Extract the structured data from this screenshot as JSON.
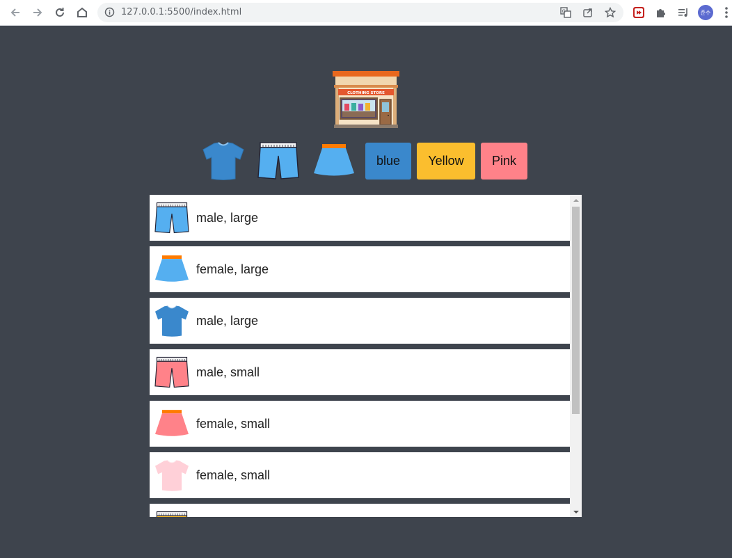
{
  "browser": {
    "url": "127.0.0.1:5500/index.html",
    "profile_initials": "준수",
    "icons": [
      "back-icon",
      "forward-icon",
      "reload-icon",
      "home-icon",
      "info-icon",
      "translate-icon",
      "share-icon",
      "bookmark-star-icon",
      "extension-red-icon",
      "puzzle-icon",
      "media-queue-icon",
      "menu-dots-icon"
    ]
  },
  "page": {
    "logo_sign": "CLOTHING STORE",
    "filters": {
      "types": [
        "tshirt",
        "pants",
        "skirt"
      ],
      "colors": [
        {
          "label": "blue",
          "color": "#3a88cc"
        },
        {
          "label": "Yellow",
          "color": "#fbbe2e"
        },
        {
          "label": "Pink",
          "color": "#ff8289"
        }
      ]
    },
    "items": [
      {
        "type": "pants",
        "color": "#55aff0",
        "label": "male, large"
      },
      {
        "type": "skirt",
        "color": "#55aff0",
        "label": "female, large"
      },
      {
        "type": "tshirt",
        "color": "#3a88cc",
        "label": "male, large"
      },
      {
        "type": "pants",
        "color": "#ff8289",
        "label": "male, small"
      },
      {
        "type": "skirt",
        "color": "#ff8289",
        "label": "female, small"
      },
      {
        "type": "tshirt",
        "color": "#ffd0d8",
        "label": "female, small"
      },
      {
        "type": "pants",
        "color": "#fbbe2e",
        "label": ""
      }
    ]
  },
  "colors": {
    "background": "#3e444d",
    "list_item": "#ffffff",
    "skirt_band": "#ff7b00"
  }
}
